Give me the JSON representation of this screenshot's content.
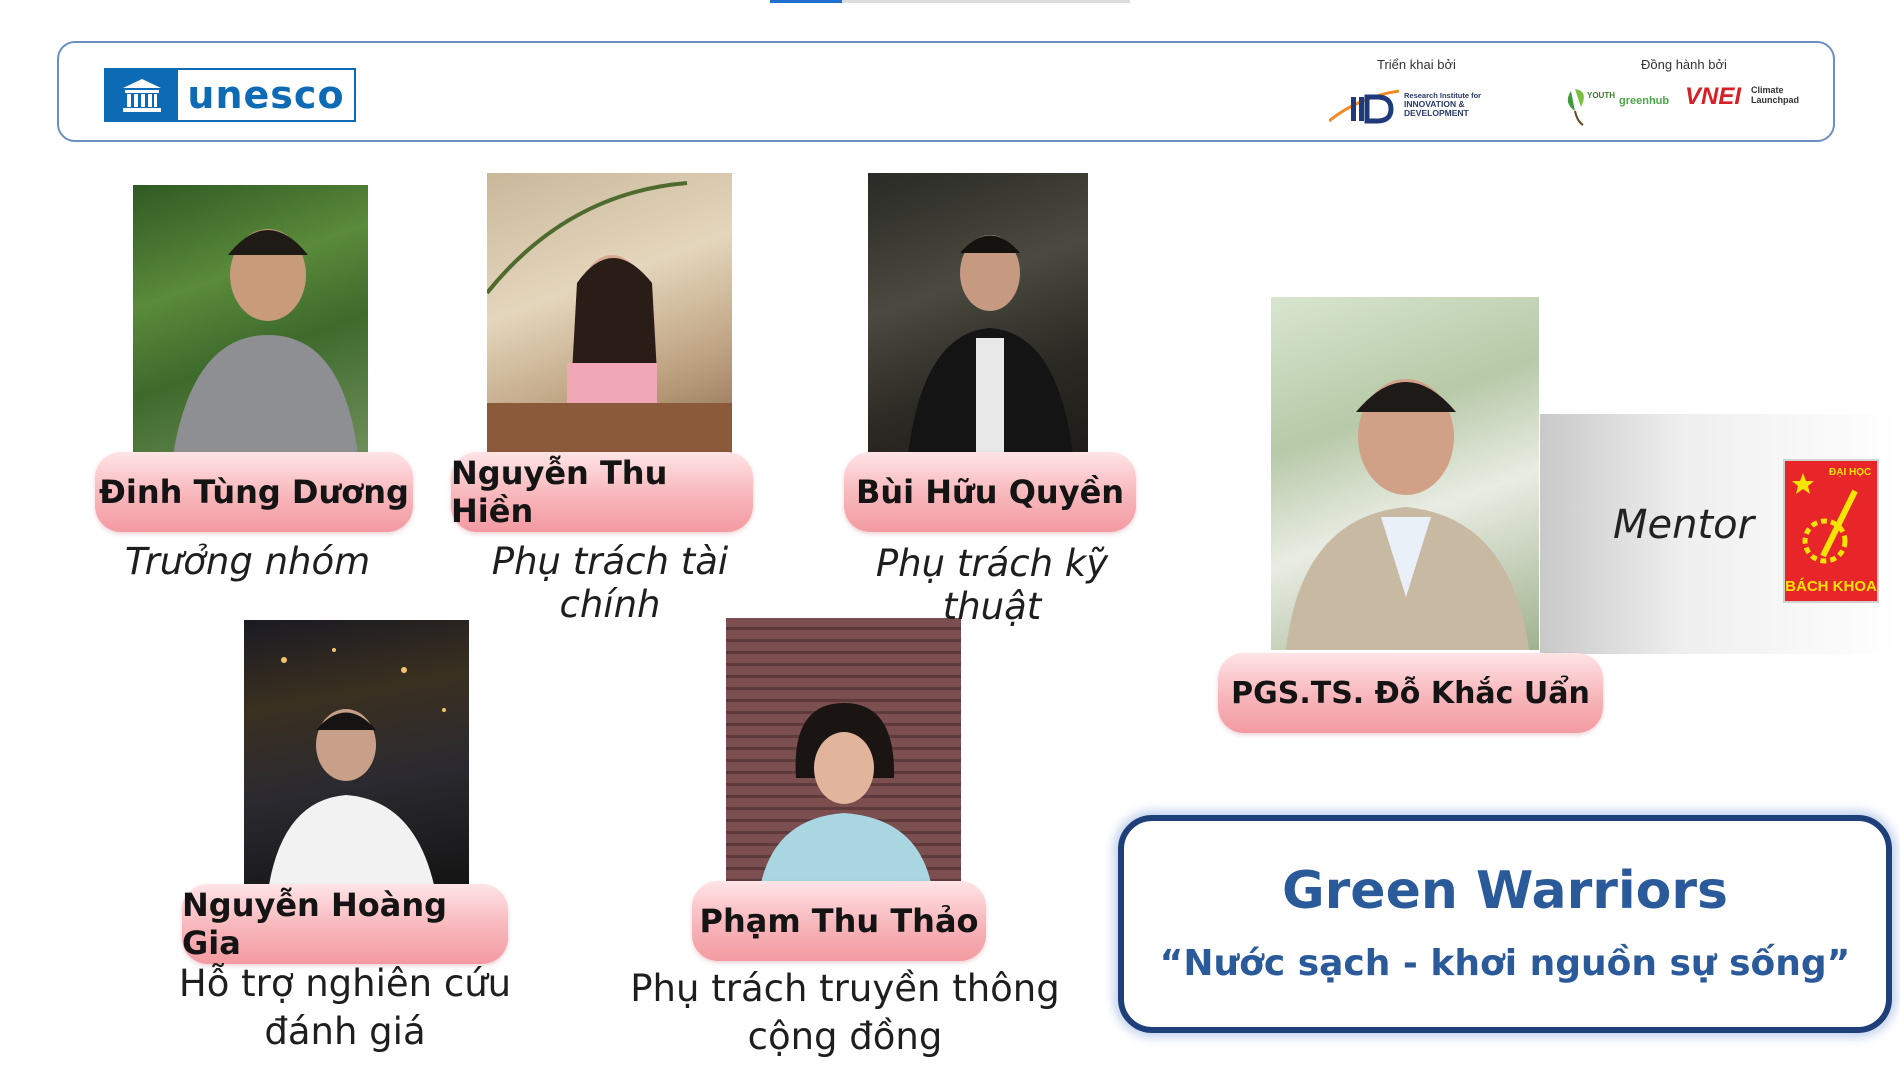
{
  "slide_progress": 0.2,
  "header": {
    "brand": "unesco",
    "sponsor_label": "Triển khai bởi",
    "partners_label": "Đồng hành bởi",
    "iid_lines": [
      "Research Institute for",
      "INNOVATION &",
      "DEVELOPMENT"
    ],
    "partners": [
      "YOUTH",
      "greenhub",
      "VNEI",
      "Climate Launchpad"
    ],
    "colors": {
      "unesco_blue": "#0d6ab5",
      "vnei_red": "#d61f26",
      "greenhub_green": "#4aa84a"
    }
  },
  "members": [
    {
      "name": "Đinh Tùng Dương",
      "role": "Trưởng nhóm",
      "icon": "person-photo"
    },
    {
      "name": "Nguyễn Thu Hiền",
      "role": "Phụ trách tài chính",
      "icon": "person-photo"
    },
    {
      "name": "Bùi Hữu Quyền",
      "role": "Phụ trách kỹ thuật",
      "icon": "person-photo"
    },
    {
      "name": "Nguyễn Hoàng Gia",
      "role_line1": "Hỗ trợ nghiên cứu",
      "role_line2": "đánh giá",
      "icon": "person-photo"
    },
    {
      "name": "Phạm Thu Thảo",
      "role_line1": "Phụ trách truyền thông",
      "role_line2": "cộng đồng",
      "icon": "person-photo"
    }
  ],
  "mentor": {
    "name": "PGS.TS. Đỗ Khắc Uẩn",
    "label": "Mentor",
    "university_line1": "ĐẠI HỌC",
    "university_line2": "BÁCH KHOA"
  },
  "team": {
    "title": "Green Warriors",
    "slogan": "“Nước sạch - khơi nguồn sự sống”"
  }
}
